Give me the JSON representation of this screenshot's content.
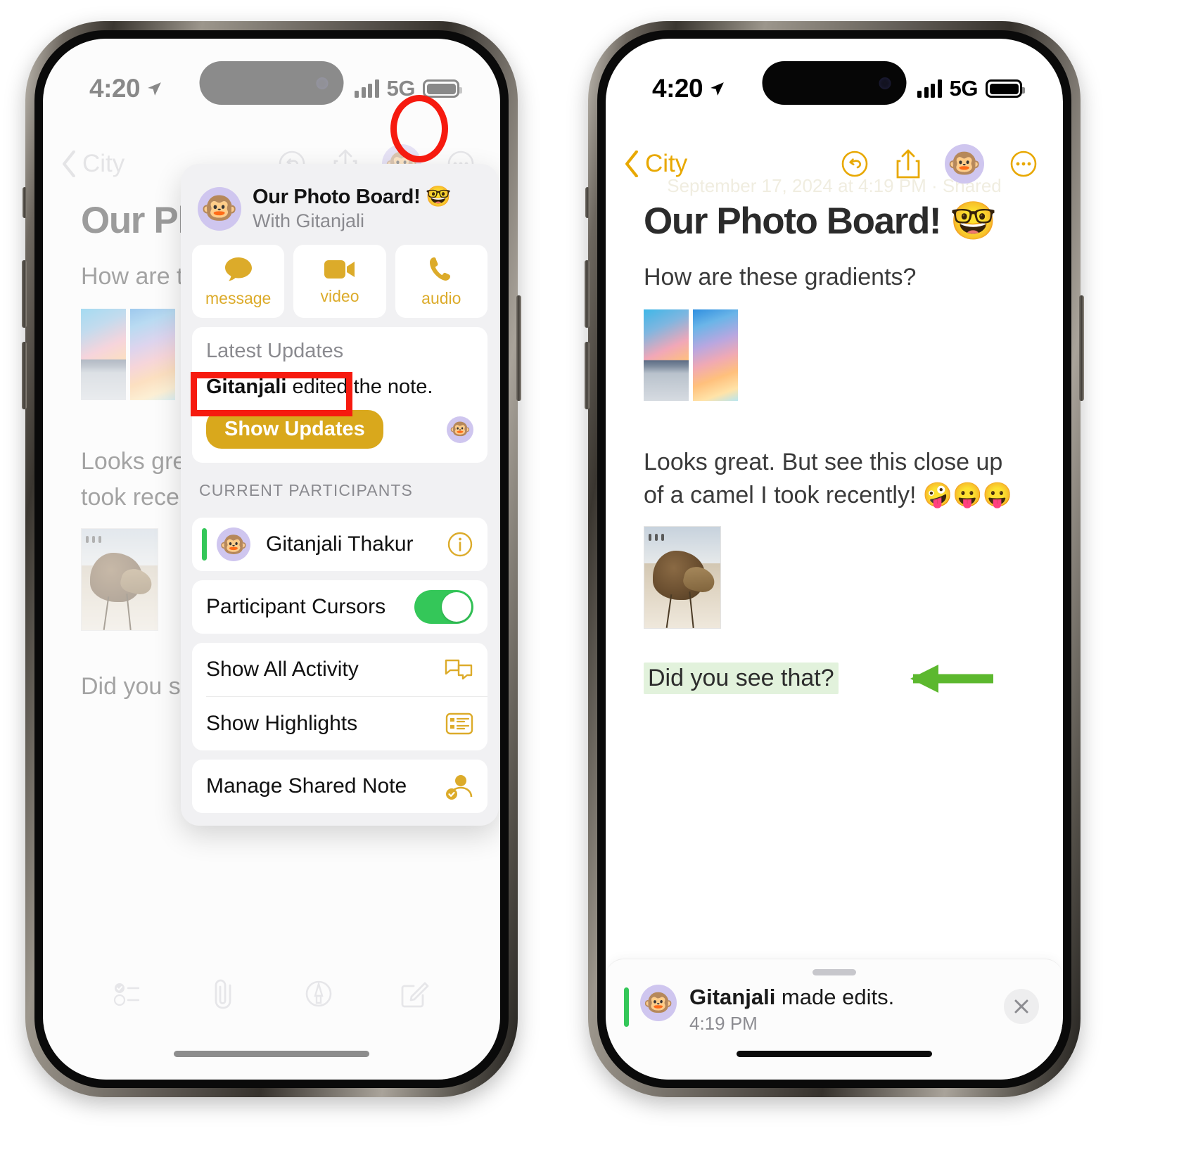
{
  "status_bar": {
    "time": "4:20",
    "network": "5G",
    "location_icon": "location-arrow-icon",
    "signal_icon": "cellular-bars-icon",
    "battery_icon": "battery-full-icon"
  },
  "nav": {
    "back_label": "City",
    "undo_icon": "undo-circle-icon",
    "share_icon": "share-up-icon",
    "collaborator_avatar": "🐵",
    "more_icon": "more-ellipsis-icon",
    "date_watermark": "September 17, 2024 at 4:19 PM · Shared"
  },
  "note": {
    "title": "Our Photo Board! 🤓",
    "paragraph_1": "How are these gradients?",
    "paragraph_2": "Looks great. But see this close up of a camel I took recently! 🤪😛😛",
    "highlighted_text": "Did you see that?",
    "highlight_color": "#e2f2dc",
    "arrow_color": "#5cb82e",
    "left_clipped": {
      "title": "Our Ph",
      "paragraph_1": "How are the",
      "paragraph_2_line1": "Looks great",
      "paragraph_2_line2": "took recentl",
      "paragraph_3": "Did you see"
    }
  },
  "toolbar": {
    "items": [
      {
        "icon": "checklist-icon",
        "label": "Checklist"
      },
      {
        "icon": "paperclip-icon",
        "label": "Attachment"
      },
      {
        "icon": "markup-pen-icon",
        "label": "Markup"
      },
      {
        "icon": "compose-icon",
        "label": "New Note"
      }
    ]
  },
  "share_popup": {
    "avatar": "🐵",
    "title": "Our Photo Board! 🤓",
    "subtitle": "With Gitanjali",
    "quick_actions": [
      {
        "icon": "message-bubble-icon",
        "label": "message"
      },
      {
        "icon": "video-camera-icon",
        "label": "video"
      },
      {
        "icon": "phone-handset-icon",
        "label": "audio"
      }
    ],
    "latest_updates": {
      "section_title": "Latest Updates",
      "update_actor": "Gitanjali",
      "update_text": " edited the note.",
      "button_label": "Show Updates",
      "button_color": "#d9a81c",
      "avatar": "🐵"
    },
    "participants_label": "CURRENT PARTICIPANTS",
    "participant": {
      "name": "Gitanjali Thakur",
      "avatar": "🐵",
      "status_color": "#34c759",
      "info_icon": "info-circle-icon"
    },
    "cursors_row": {
      "label": "Participant Cursors",
      "toggle_on": true,
      "toggle_color": "#34c759"
    },
    "menu_items": [
      {
        "label": "Show All Activity",
        "icon": "activity-bubbles-icon"
      },
      {
        "label": "Show Highlights",
        "icon": "highlights-list-icon"
      }
    ],
    "manage_item": {
      "label": "Manage Shared Note",
      "icon": "manage-person-icon"
    }
  },
  "activity_banner": {
    "actor": "Gitanjali",
    "text": " made edits.",
    "time": "4:19 PM",
    "avatar": "🐵",
    "status_color": "#34c759",
    "close_icon": "close-x-icon"
  },
  "annotations": {
    "circle_target": "collaborator-avatar-button",
    "rect_target": "show-updates-button",
    "color": "#f61a0f"
  },
  "accent_colors": {
    "tint": "#E8A800",
    "yellow_icon": "#dcab2a",
    "green": "#34c759"
  }
}
